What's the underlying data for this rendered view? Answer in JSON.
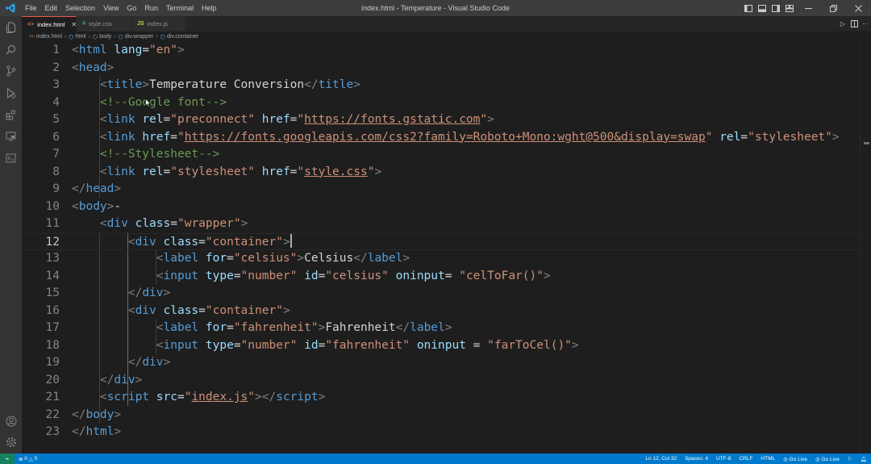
{
  "window": {
    "title": "index.html - Temperature - Visual Studio Code"
  },
  "menu": [
    "File",
    "Edit",
    "Selection",
    "View",
    "Go",
    "Run",
    "Terminal",
    "Help"
  ],
  "tabs": [
    {
      "label": "index.html",
      "icon": "<>",
      "icon_color": "#e37933",
      "active": true
    },
    {
      "label": "style.css",
      "icon": "#",
      "icon_color": "#519aba",
      "active": false
    },
    {
      "label": "index.js",
      "icon": "JS",
      "icon_color": "#cbcb41",
      "active": false
    }
  ],
  "breadcrumb": [
    "index.html",
    "html",
    "body",
    "div.wrapper",
    "div.container"
  ],
  "editor": {
    "current_line": 12,
    "lines": [
      {
        "n": "1"
      },
      {
        "n": "2"
      },
      {
        "n": "3"
      },
      {
        "n": "4"
      },
      {
        "n": "5"
      },
      {
        "n": "6"
      },
      {
        "n": "7"
      },
      {
        "n": "8"
      },
      {
        "n": "9"
      },
      {
        "n": "10"
      },
      {
        "n": "11"
      },
      {
        "n": "12"
      },
      {
        "n": "13"
      },
      {
        "n": "14"
      },
      {
        "n": "15"
      },
      {
        "n": "16"
      },
      {
        "n": "17"
      },
      {
        "n": "18"
      },
      {
        "n": "19"
      },
      {
        "n": "20"
      },
      {
        "n": "21"
      },
      {
        "n": "22"
      },
      {
        "n": "23"
      }
    ],
    "tokens": {
      "l1": [
        "<",
        "html",
        " ",
        "lang",
        "=",
        "\"en\"",
        ">"
      ],
      "l2": [
        "<",
        "head",
        ">"
      ],
      "l3": [
        "<",
        "title",
        ">",
        "Temperature Conversion",
        "</",
        "title",
        ">"
      ],
      "l4": [
        "<!--Google font-->"
      ],
      "l5": [
        "<",
        "link",
        " ",
        "rel",
        "=",
        "\"preconnect\"",
        " ",
        "href",
        "=",
        "\"",
        "https://fonts.gstatic.com",
        "\"",
        ">"
      ],
      "l6": [
        "<",
        "link",
        " ",
        "href",
        "=",
        "\"",
        "https://fonts.googleapis.com/css2?family=Roboto+Mono:wght@500&display=swap",
        "\"",
        " ",
        "rel",
        "=",
        "\"stylesheet\"",
        ">"
      ],
      "l7": [
        "<!--Stylesheet-->"
      ],
      "l8": [
        "<",
        "link",
        " ",
        "rel",
        "=",
        "\"stylesheet\"",
        " ",
        "href",
        "=",
        "\"",
        "style.css",
        "\"",
        ">"
      ],
      "l9": [
        "</",
        "head",
        ">"
      ],
      "l10": [
        "<",
        "body",
        ">",
        "-"
      ],
      "l11": [
        "<",
        "div",
        " ",
        "class",
        "=",
        "\"wrapper\"",
        ">"
      ],
      "l12": [
        "<",
        "div",
        " ",
        "class",
        "=",
        "\"container\"",
        ">"
      ],
      "l13": [
        "<",
        "label",
        " ",
        "for",
        "=",
        "\"celsius\"",
        ">",
        "Celsius",
        "</",
        "label",
        ">"
      ],
      "l14": [
        "<",
        "input",
        " ",
        "type",
        "=",
        "\"number\"",
        " ",
        "id",
        "=",
        "\"celsius\"",
        " ",
        "oninput",
        "= ",
        "\"celToFar()\"",
        ">"
      ],
      "l15": [
        "</",
        "div",
        ">"
      ],
      "l16": [
        "<",
        "div",
        " ",
        "class",
        "=",
        "\"container\"",
        ">"
      ],
      "l17": [
        "<",
        "label",
        " ",
        "for",
        "=",
        "\"fahrenheit\"",
        ">",
        "Fahrenheit",
        "</",
        "label",
        ">"
      ],
      "l18": [
        "<",
        "input",
        " ",
        "type",
        "=",
        "\"number\"",
        " ",
        "id",
        "=",
        "\"fahrenheit\"",
        " ",
        "oninput",
        " = ",
        "\"farToCel()\"",
        ">"
      ],
      "l19": [
        "</",
        "div",
        ">"
      ],
      "l20": [
        "</",
        "div",
        ">"
      ],
      "l21": [
        "<",
        "script",
        " ",
        "src",
        "=",
        "\"",
        "index.js",
        "\"",
        "></",
        "script",
        ">"
      ],
      "l22": [
        "</",
        "body",
        ">"
      ],
      "l23": [
        "</",
        "html",
        ">"
      ]
    }
  },
  "statusbar": {
    "errors": "0",
    "warnings": "0",
    "position": "Ln 12, Col 32",
    "spaces": "Spaces: 4",
    "encoding": "UTF-8",
    "eol": "CRLF",
    "language": "HTML",
    "golive1": "Go Live",
    "golive2": "Go Live"
  },
  "colors": {
    "accent": "#007acc",
    "remote": "#16825d",
    "tag": "#569cd6",
    "attr": "#9cdcfe",
    "string": "#ce9178",
    "comment": "#6a9955"
  }
}
